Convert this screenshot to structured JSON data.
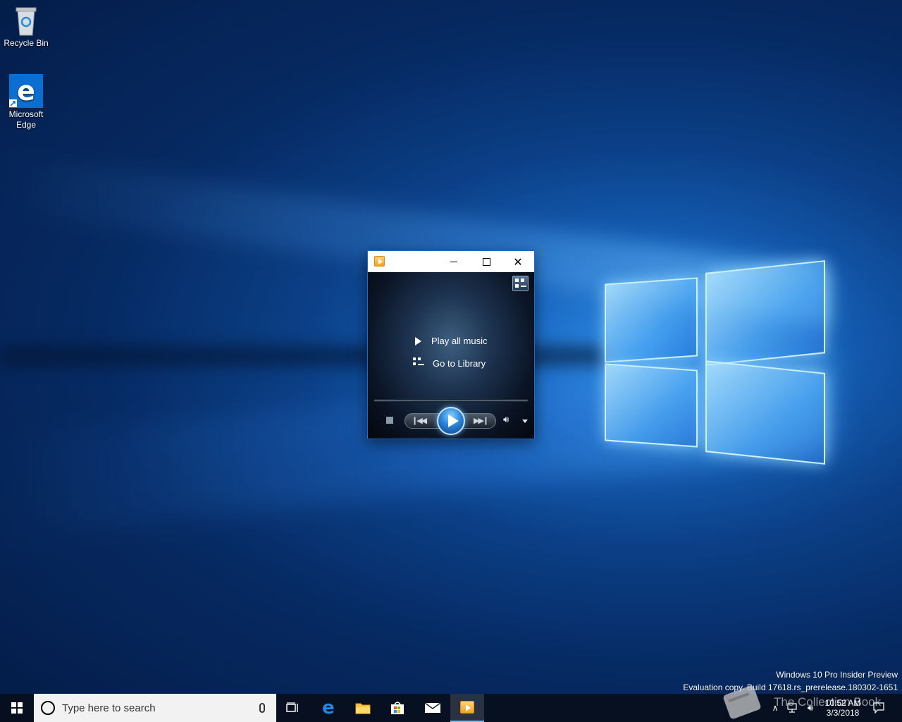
{
  "desktop": {
    "icons": [
      {
        "label": "Recycle Bin"
      },
      {
        "label": "Microsoft Edge"
      }
    ]
  },
  "wmp_window": {
    "play_all_label": "Play all music",
    "go_to_library_label": "Go to Library"
  },
  "watermark": {
    "line1": "Windows 10 Pro Insider Preview",
    "line2": "Evaluation copy. Build 17618.rs_prerelease.180302-1651",
    "collection_text": "The Collection Book"
  },
  "taskbar": {
    "search_placeholder": "Type here to search",
    "clock_time": "10:52 AM",
    "clock_date": "3/3/2018"
  },
  "colors": {
    "accent": "#76b9ed",
    "wallpaper_dark": "#041c47",
    "wallpaper_light": "#2f8de6"
  }
}
